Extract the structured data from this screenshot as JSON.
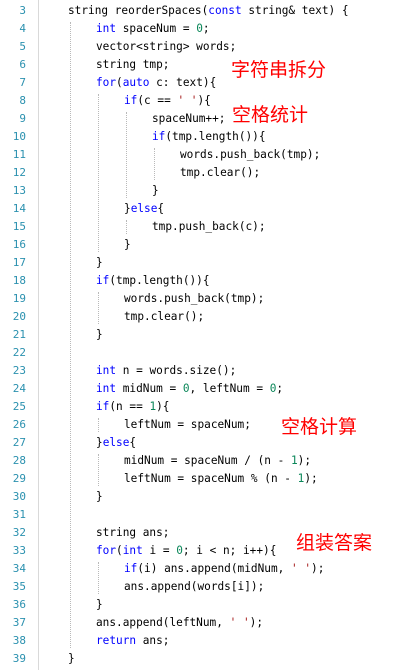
{
  "line_numbers": [
    "3",
    "4",
    "5",
    "6",
    "7",
    "8",
    "9",
    "10",
    "11",
    "12",
    "13",
    "14",
    "15",
    "16",
    "17",
    "18",
    "19",
    "20",
    "21",
    "22",
    "23",
    "24",
    "25",
    "26",
    "27",
    "28",
    "29",
    "30",
    "31",
    "32",
    "33",
    "34",
    "35",
    "36",
    "37",
    "38",
    "39"
  ],
  "lines": [
    [
      {
        "t": "string reorderSpaces("
      },
      {
        "t": "const",
        "c": "kw"
      },
      {
        "t": " string& text) {"
      }
    ],
    [
      {
        "t": "int",
        "c": "kw"
      },
      {
        "t": " spaceNum = "
      },
      {
        "t": "0",
        "c": "num"
      },
      {
        "t": ";"
      }
    ],
    [
      {
        "t": "vector<string> words;"
      }
    ],
    [
      {
        "t": "string tmp;"
      }
    ],
    [
      {
        "t": "for",
        "c": "kw"
      },
      {
        "t": "("
      },
      {
        "t": "auto",
        "c": "kw"
      },
      {
        "t": " c: text){"
      }
    ],
    [
      {
        "t": "if",
        "c": "kw"
      },
      {
        "t": "(c == "
      },
      {
        "t": "' '",
        "c": "str"
      },
      {
        "t": "){"
      }
    ],
    [
      {
        "t": "spaceNum++;"
      }
    ],
    [
      {
        "t": "if",
        "c": "kw"
      },
      {
        "t": "(tmp.length()){"
      }
    ],
    [
      {
        "t": "words.push_back(tmp);"
      }
    ],
    [
      {
        "t": "tmp.clear();"
      }
    ],
    [
      {
        "t": "}"
      }
    ],
    [
      {
        "t": "}"
      },
      {
        "t": "else",
        "c": "kw"
      },
      {
        "t": "{"
      }
    ],
    [
      {
        "t": "tmp.push_back(c);"
      }
    ],
    [
      {
        "t": "}"
      }
    ],
    [
      {
        "t": "}"
      }
    ],
    [
      {
        "t": "if",
        "c": "kw"
      },
      {
        "t": "(tmp.length()){"
      }
    ],
    [
      {
        "t": "words.push_back(tmp);"
      }
    ],
    [
      {
        "t": "tmp.clear();"
      }
    ],
    [
      {
        "t": "}"
      }
    ],
    [],
    [
      {
        "t": "int",
        "c": "kw"
      },
      {
        "t": " n = words.size();"
      }
    ],
    [
      {
        "t": "int",
        "c": "kw"
      },
      {
        "t": " midNum = "
      },
      {
        "t": "0",
        "c": "num"
      },
      {
        "t": ", leftNum = "
      },
      {
        "t": "0",
        "c": "num"
      },
      {
        "t": ";"
      }
    ],
    [
      {
        "t": "if",
        "c": "kw"
      },
      {
        "t": "(n == "
      },
      {
        "t": "1",
        "c": "num"
      },
      {
        "t": "){"
      }
    ],
    [
      {
        "t": "leftNum = spaceNum;"
      }
    ],
    [
      {
        "t": "}"
      },
      {
        "t": "else",
        "c": "kw"
      },
      {
        "t": "{"
      }
    ],
    [
      {
        "t": "midNum = spaceNum / (n - "
      },
      {
        "t": "1",
        "c": "num"
      },
      {
        "t": ");"
      }
    ],
    [
      {
        "t": "leftNum = spaceNum % (n - "
      },
      {
        "t": "1",
        "c": "num"
      },
      {
        "t": ");"
      }
    ],
    [
      {
        "t": "}"
      }
    ],
    [],
    [
      {
        "t": "string ans;"
      }
    ],
    [
      {
        "t": "for",
        "c": "kw"
      },
      {
        "t": "("
      },
      {
        "t": "int",
        "c": "kw"
      },
      {
        "t": " i = "
      },
      {
        "t": "0",
        "c": "num"
      },
      {
        "t": "; i < n; i++){"
      }
    ],
    [
      {
        "t": "if",
        "c": "kw"
      },
      {
        "t": "(i) ans.append(midNum, "
      },
      {
        "t": "' '",
        "c": "str"
      },
      {
        "t": ");"
      }
    ],
    [
      {
        "t": "ans.append(words[i]);"
      }
    ],
    [
      {
        "t": "}"
      }
    ],
    [
      {
        "t": "ans.append(leftNum, "
      },
      {
        "t": "' '",
        "c": "str"
      },
      {
        "t": ");"
      }
    ],
    [
      {
        "t": "return",
        "c": "kw"
      },
      {
        "t": " ans;"
      }
    ],
    [
      {
        "t": "}"
      }
    ]
  ],
  "annotations": {
    "split_string": "字符串拆分",
    "count_spaces": "空格统计",
    "compute_spaces": "空格计算",
    "assemble_answer": "组装答案"
  },
  "colors": {
    "line_number": "#2b91af",
    "keyword": "#0000ff",
    "number": "#098658",
    "string": "#a31515",
    "annotation": "#ff0000"
  }
}
